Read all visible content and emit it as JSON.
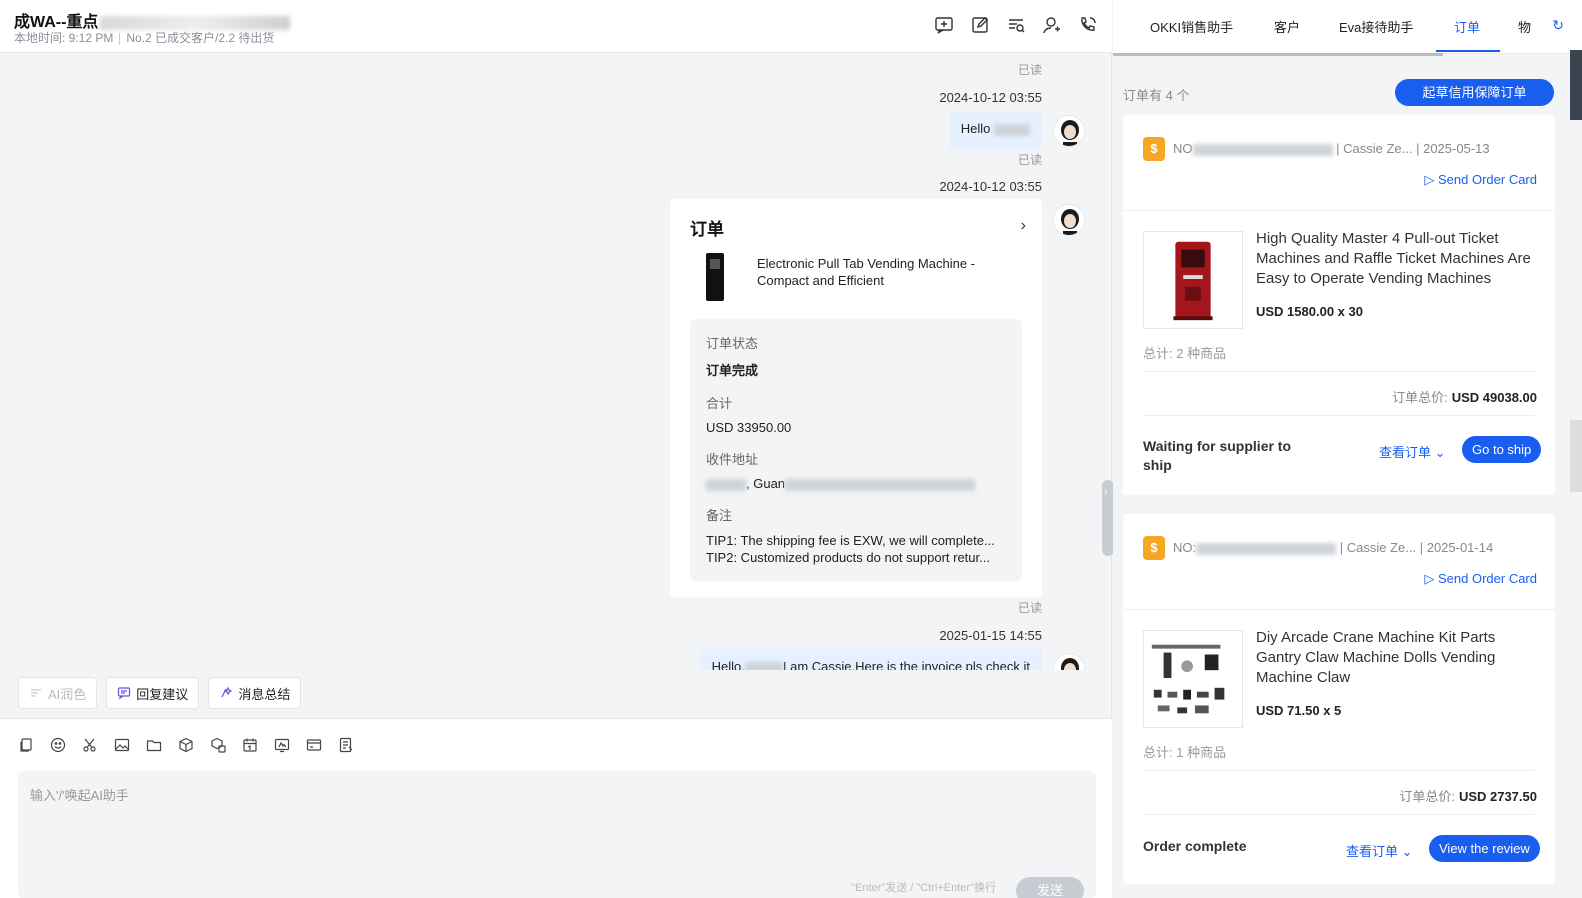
{
  "chat": {
    "title_prefix": "成WA--重点",
    "local_time": "本地时间: 9:12 PM",
    "customer_info": "No.2 已成交客户/2.2 待出货",
    "messages": {
      "read_1": "已读",
      "ts_1": "2024-10-12 03:55",
      "hello_1": "Hello",
      "read_2": "已读",
      "ts_2": "2024-10-12 03:55",
      "read_3": "已读",
      "ts_3": "2025-01-15 14:55",
      "hello_3_a": "Hello.",
      "hello_3_b": "I am Cassie.Here is the invoice pls check it"
    },
    "order_card": {
      "title": "订单",
      "product_name": "Electronic Pull Tab Vending Machine - Compact and Efficient",
      "status_label": "订单状态",
      "status_value": "订单完成",
      "total_label": "合计",
      "total_value": "USD 33950.00",
      "address_label": "收件地址",
      "address_value": ", Guan",
      "remark_label": "备注",
      "tip1": "TIP1: The shipping fee is EXW, we will complete...",
      "tip2": "TIP2: Customized products do not support retur..."
    },
    "ai_buttons": [
      "AI润色",
      "回复建议",
      "消息总结"
    ],
    "input_placeholder": "输入'/'唤起AI助手",
    "send_hint": "\"Enter\"发送 / \"Ctrl+Enter\"换行",
    "send_label": "发送"
  },
  "panel": {
    "tabs": [
      "OKKI销售助手",
      "客户",
      "Eva接待助手",
      "订单",
      "物"
    ],
    "active_tab": "订单",
    "order_count": "订单有 4 个",
    "draft_button": "起草信用保障订单",
    "orders": [
      {
        "no_prefix": "NO",
        "seller": "| Cassie Ze...",
        "date": "| 2025-05-13",
        "send_card": "Send Order Card",
        "product_name": "High Quality Master 4 Pull-out Ticket Machines and Raffle Ticket Machines Are Easy to Operate Vending Machines",
        "price": "USD 1580.00 x 30",
        "total_count": "总计: 2 种商品",
        "total_label": "订单总价:",
        "total_value": "USD 49038.00",
        "status": "Waiting for supplier to ship",
        "view_order": "查看订单",
        "action": "Go to ship"
      },
      {
        "no_prefix": "NO:",
        "seller": "| Cassie Ze...",
        "date": "| 2025-01-14",
        "send_card": "Send Order Card",
        "product_name": "Diy Arcade Crane Machine Kit Parts Gantry Claw Machine Dolls Vending Machine Claw",
        "price": "USD 71.50 x 5",
        "total_count": "总计: 1 种商品",
        "total_label": "订单总价:",
        "total_value": "USD 2737.50",
        "status": "Order complete",
        "view_order": "查看订单",
        "action": "View the review"
      }
    ]
  },
  "colors": {
    "accent": "#1a5ef0",
    "bubble": "#e6f0ff",
    "coin": "#f5a623"
  }
}
